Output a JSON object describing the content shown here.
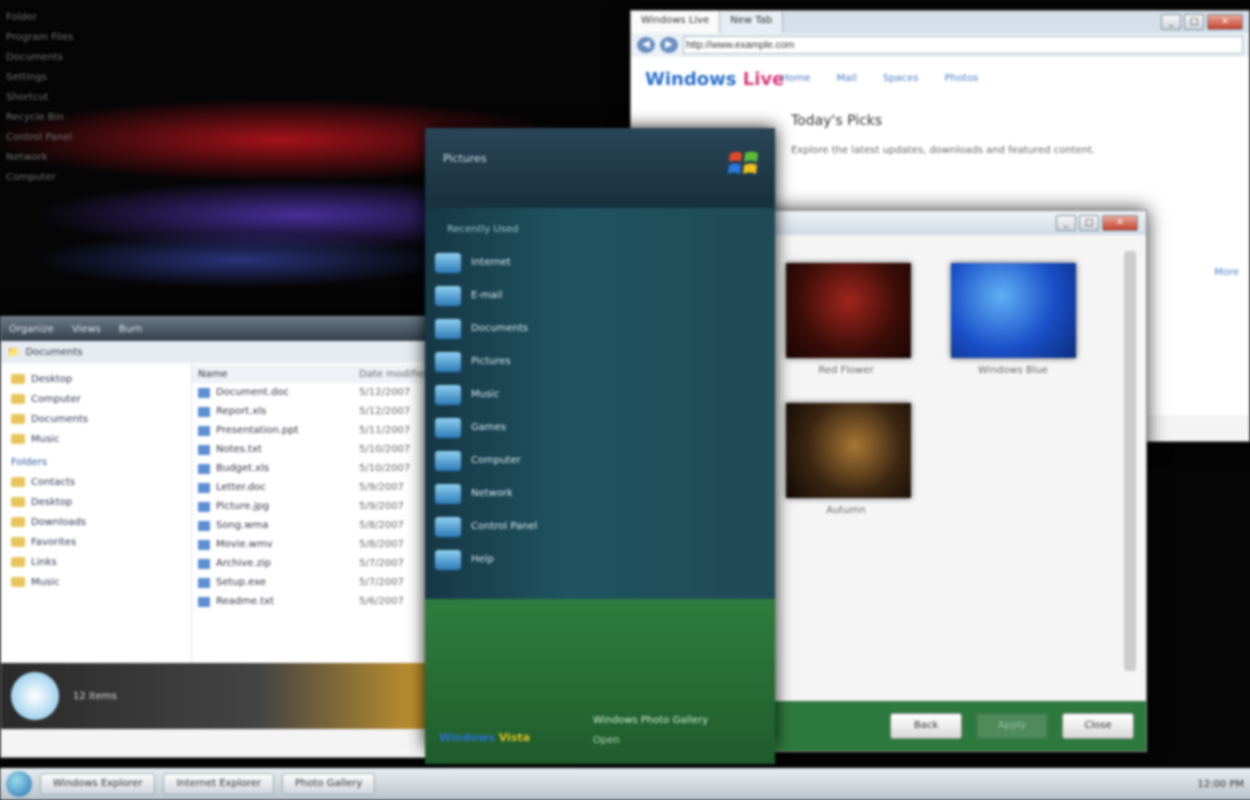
{
  "desktop": {
    "text_lines": [
      "Folder",
      "Program Files",
      "Documents",
      "Settings",
      "Shortcut",
      "Recycle Bin",
      "Control Panel",
      "Network",
      "Computer"
    ]
  },
  "browser": {
    "tabs": [
      "Windows Live",
      "New Tab"
    ],
    "address": "http://www.example.com",
    "logo_a": "Windows",
    "logo_b": "Live",
    "nav": [
      "Home",
      "Mail",
      "Spaces",
      "Photos"
    ],
    "heading": "Today's Picks",
    "text": "Explore the latest updates, downloads and featured content.",
    "side_link": "More"
  },
  "explorer": {
    "toolbar": [
      "Organize",
      "Views",
      "Burn"
    ],
    "address": "Documents",
    "nav_top": [
      "Desktop",
      "Computer",
      "Documents",
      "Music"
    ],
    "section": "Folders",
    "folders": [
      "Contacts",
      "Desktop",
      "Downloads",
      "Favorites",
      "Links",
      "Music"
    ],
    "header_name": "Name",
    "header_date": "Date modified",
    "files": [
      "Document.doc",
      "Report.xls",
      "Presentation.ppt",
      "Notes.txt",
      "Budget.xls",
      "Letter.doc",
      "Picture.jpg",
      "Song.wma",
      "Movie.wmv",
      "Archive.zip",
      "Setup.exe",
      "Readme.txt"
    ],
    "dates": [
      "5/12/2007",
      "5/12/2007",
      "5/11/2007",
      "5/10/2007",
      "5/10/2007",
      "5/9/2007",
      "5/9/2007",
      "5/8/2007",
      "5/8/2007",
      "5/7/2007",
      "5/7/2007",
      "5/6/2007"
    ],
    "details": "12 items"
  },
  "gallery": {
    "captions": [
      "Red Flower",
      "Windows Blue",
      "Autumn"
    ],
    "footer_buttons": [
      "Back",
      "Apply",
      "Close"
    ]
  },
  "startmenu": {
    "title": "Pictures",
    "list_header": "Recently Used",
    "items": [
      "Internet",
      "E-mail",
      "Documents",
      "Pictures",
      "Music",
      "Games",
      "Computer",
      "Network",
      "Control Panel",
      "Help"
    ],
    "brand_a": "Windows",
    "brand_b": "Vista",
    "status1": "Windows Photo Gallery",
    "status2": "Open"
  },
  "taskbar": {
    "tasks": [
      "Windows Explorer",
      "Internet Explorer",
      "Photo Gallery"
    ],
    "clock": "12:00 PM"
  }
}
